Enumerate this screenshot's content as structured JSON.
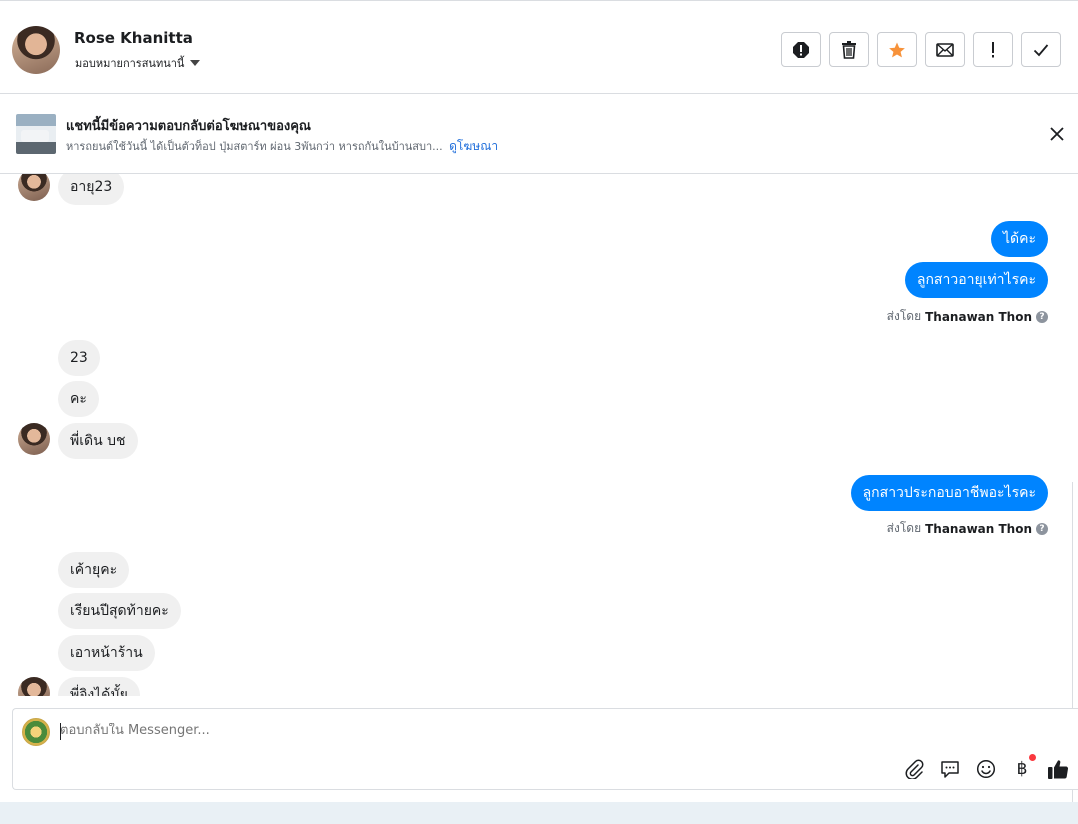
{
  "header": {
    "contact_name": "Rose Khanitta",
    "assign_label": "มอบหมายการสนทนานี้",
    "actions": [
      {
        "name": "spam-button",
        "icon": "alert-circle-icon"
      },
      {
        "name": "delete-button",
        "icon": "trash-icon"
      },
      {
        "name": "star-button",
        "icon": "star-icon",
        "color": "#f7923a"
      },
      {
        "name": "mark-unread-button",
        "icon": "envelope-icon"
      },
      {
        "name": "follow-up-button",
        "icon": "exclamation-icon"
      },
      {
        "name": "mark-done-button",
        "icon": "check-icon"
      }
    ]
  },
  "ad_banner": {
    "title": "แชทนี้มีข้อความตอบกลับต่อโฆษณาของคุณ",
    "subtitle": "หารถยนต์ใช้วันนี้ ได้เป็นตัวท็อป ปุ่มสตาร์ท ผ่อน 3พันกว่า หารถกันในบ้านสบา...",
    "link_label": "ดูโฆษณา"
  },
  "messages": {
    "m1": "อายุ23",
    "m2": "ได้คะ",
    "m3": "ลูกสาวอายุเท่าไรคะ",
    "sent_prefix_1": "ส่งโดย",
    "sender_1": "Thanawan Thon",
    "m4": "23",
    "m5": "คะ",
    "m6": "พี่เดิน บช",
    "m7": "ลูกสาวประกอบอาชีพอะไรคะ",
    "sent_prefix_2": "ส่งโดย",
    "sender_2": "Thanawan Thon",
    "m8": "เค้ายุคะ",
    "m9": "เรียนปีสุดท้ายคะ",
    "m10": "เอาหน้าร้าน",
    "m11": "พี่จิงได้มั้ย",
    "help_glyph": "?"
  },
  "composer": {
    "placeholder": "ตอบกลับใน Messenger...",
    "currency_glyph": "฿"
  },
  "colors": {
    "outgoing_bubble": "#0084ff",
    "incoming_bubble": "#f0f0f0",
    "link": "#216fdb",
    "like_icon": "#1c1e21"
  }
}
